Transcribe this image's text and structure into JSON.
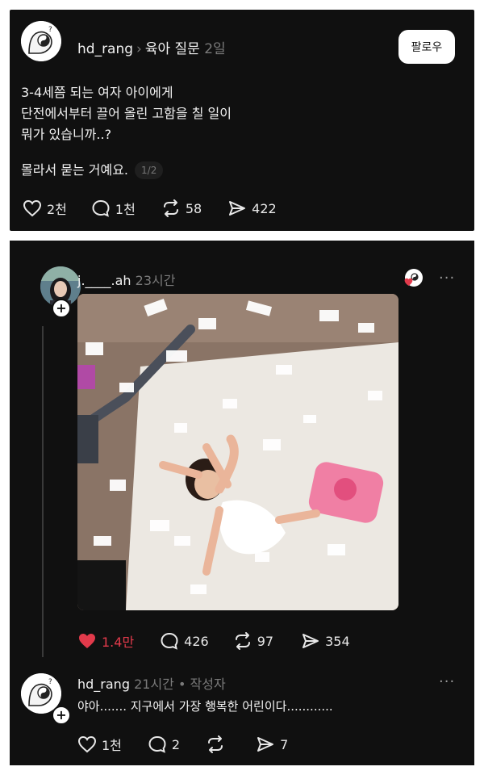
{
  "post": {
    "username": "hd_rang",
    "separator": "›",
    "community": "육아 질문",
    "time": "2일",
    "follow_label": "팔로우",
    "lines": [
      "3-4세쯤 되는 여자 아이에게",
      "단전에서부터 끌어 올린 고함을 칠 일이",
      "뭐가 있습니까..?"
    ],
    "second_line": "몰라서 묻는 거예요.",
    "page_indicator": "1/2",
    "stats": {
      "likes": "2천",
      "comments": "1천",
      "reposts": "58",
      "shares": "422"
    }
  },
  "reply": {
    "username": "j.____.ah",
    "time": "23시간",
    "more_label": "···",
    "image_alt": "photo-girl-lying-in-styrofoam",
    "stats": {
      "likes": "1.4만",
      "comments": "426",
      "reposts": "97",
      "shares": "354"
    },
    "like_color": "#e23a4b"
  },
  "comment": {
    "username": "hd_rang",
    "time": "21시간",
    "dot": "•",
    "author_label": "작성자",
    "more_label": "···",
    "text": "야아....... 지구에서 가장 행복한 어린이다............",
    "stats": {
      "likes": "1천",
      "comments": "2",
      "reposts": "",
      "shares": "7"
    }
  }
}
